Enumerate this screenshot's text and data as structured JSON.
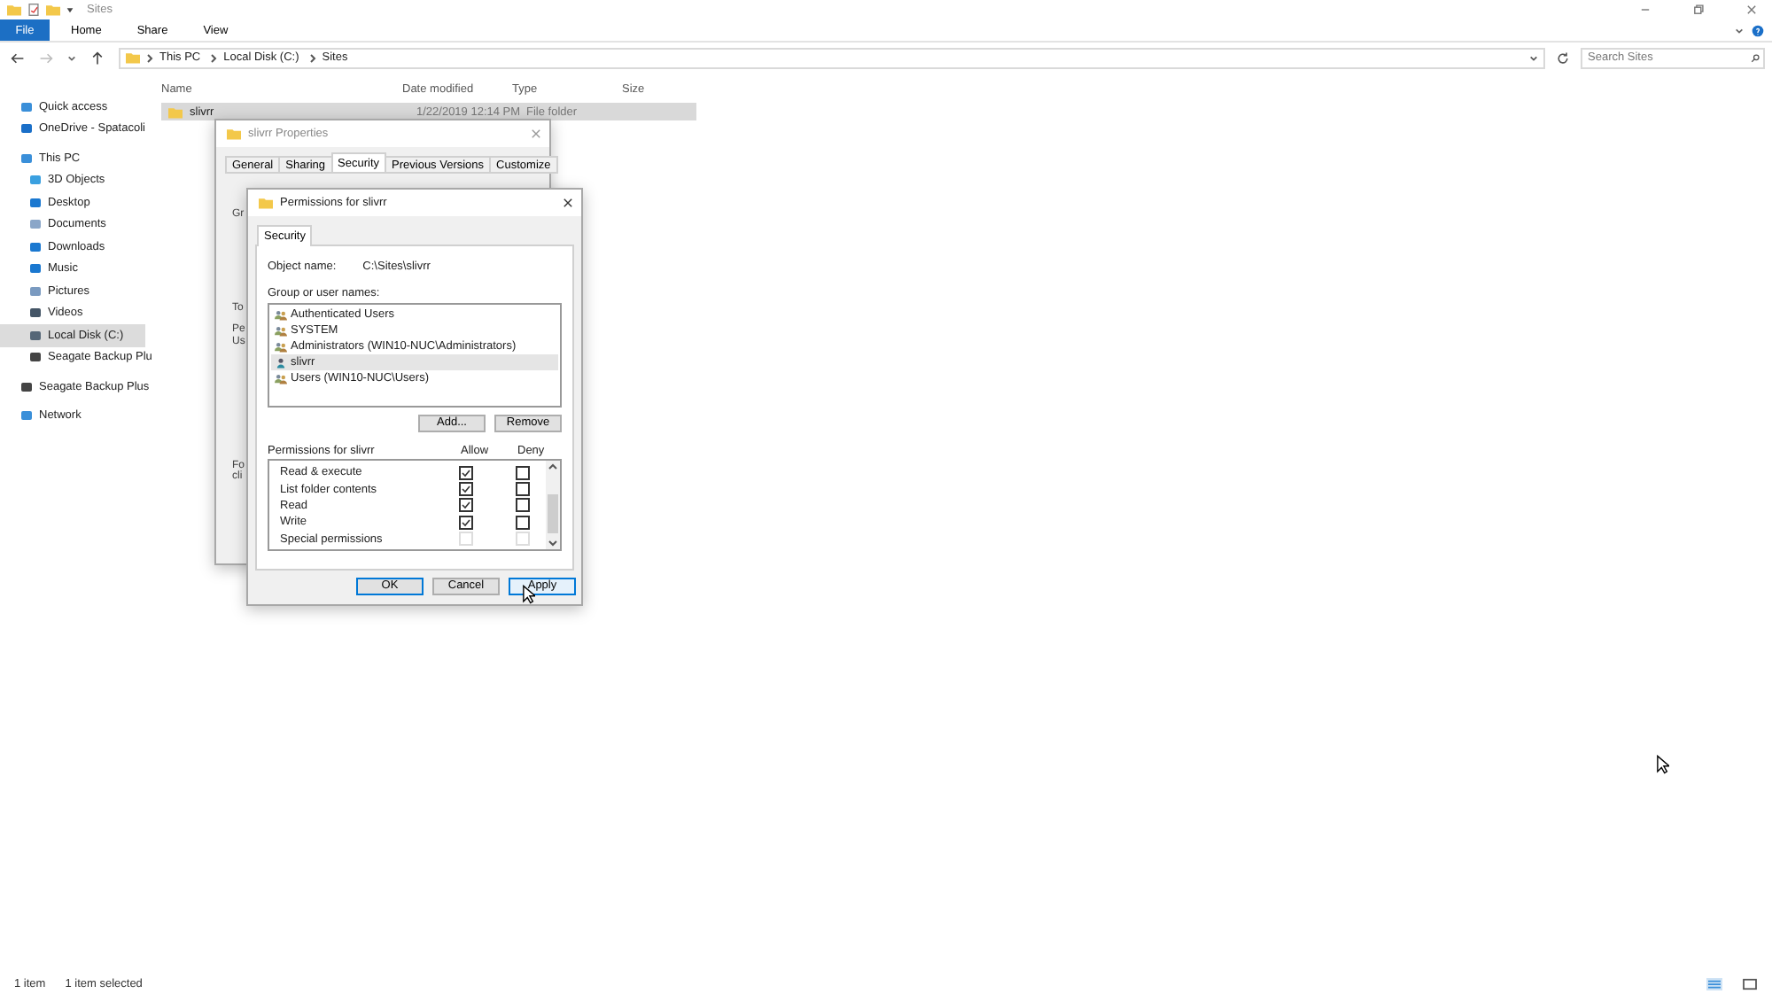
{
  "window": {
    "title": "Sites"
  },
  "file_tab": "File",
  "ribbon_tabs": [
    "Home",
    "Share",
    "View"
  ],
  "address": {
    "path": [
      "This PC",
      "Local Disk (C:)",
      "Sites"
    ]
  },
  "search": {
    "placeholder": "Search Sites"
  },
  "sidebar": {
    "items": [
      {
        "label": "Quick access",
        "kind": "star",
        "selected": false
      },
      {
        "label": "OneDrive - Spatacoli",
        "kind": "cloud",
        "selected": false
      },
      {
        "label": "This PC",
        "kind": "pc",
        "selected": false,
        "children": [
          {
            "label": "3D Objects",
            "kind": "cube",
            "selected": false
          },
          {
            "label": "Desktop",
            "kind": "desktop",
            "selected": false
          },
          {
            "label": "Documents",
            "kind": "doc",
            "selected": false
          },
          {
            "label": "Downloads",
            "kind": "download",
            "selected": false
          },
          {
            "label": "Music",
            "kind": "music",
            "selected": false
          },
          {
            "label": "Pictures",
            "kind": "pictures",
            "selected": false
          },
          {
            "label": "Videos",
            "kind": "video",
            "selected": false
          },
          {
            "label": "Local Disk (C:)",
            "kind": "disk",
            "selected": true
          },
          {
            "label": "Seagate Backup Plu",
            "kind": "drive",
            "selected": false
          }
        ]
      },
      {
        "label": "Seagate Backup Plus",
        "kind": "drive",
        "selected": false
      },
      {
        "label": "Network",
        "kind": "network",
        "selected": false
      }
    ]
  },
  "table": {
    "columns": [
      "Name",
      "Date modified",
      "Type",
      "Size"
    ],
    "rows": [
      {
        "name": "slivrr",
        "date_modified": "1/22/2019 12:14 PM",
        "type": "File folder",
        "selected": true
      }
    ]
  },
  "properties_dialog": {
    "title": "slivrr Properties",
    "tabs": [
      {
        "label": "General",
        "selected": false
      },
      {
        "label": "Sharing",
        "selected": false
      },
      {
        "label": "Security",
        "selected": true
      },
      {
        "label": "Previous Versions",
        "selected": false
      },
      {
        "label": "Customize",
        "selected": false
      }
    ],
    "fragments": [
      "Gr",
      "To",
      "Pe",
      "Us",
      "Fo",
      "cli"
    ]
  },
  "permissions_dialog": {
    "title": "Permissions for slivrr",
    "tab": "Security",
    "object_label": "Object name:",
    "object_value": "C:\\Sites\\slivrr",
    "group_label": "Group or user names:",
    "users": [
      {
        "name": "Authenticated Users",
        "kind": "group",
        "selected": false
      },
      {
        "name": "SYSTEM",
        "kind": "group",
        "selected": false
      },
      {
        "name": "Administrators (WIN10-NUC\\Administrators)",
        "kind": "group",
        "selected": false
      },
      {
        "name": "slivrr",
        "kind": "user",
        "selected": true
      },
      {
        "name": "Users (WIN10-NUC\\Users)",
        "kind": "group",
        "selected": false
      }
    ],
    "buttons": [
      "Add...",
      "Remove"
    ],
    "permissions_label": "Permissions for slivrr",
    "allow_label": "Allow",
    "deny_label": "Deny",
    "permissions": [
      {
        "name": "Read & execute",
        "allow": true,
        "deny": false,
        "disabled": false
      },
      {
        "name": "List folder contents",
        "allow": true,
        "deny": false,
        "disabled": false
      },
      {
        "name": "Read",
        "allow": true,
        "deny": false,
        "disabled": false
      },
      {
        "name": "Write",
        "allow": true,
        "deny": false,
        "disabled": false
      },
      {
        "name": "Special permissions",
        "allow": false,
        "deny": false,
        "disabled": true
      }
    ],
    "footer_buttons": [
      {
        "label": "OK",
        "kind": "default"
      },
      {
        "label": "Cancel",
        "kind": "normal"
      },
      {
        "label": "Apply",
        "kind": "hover"
      }
    ]
  },
  "status_bar": {
    "count": "1 item",
    "selection": "1 item selected"
  }
}
